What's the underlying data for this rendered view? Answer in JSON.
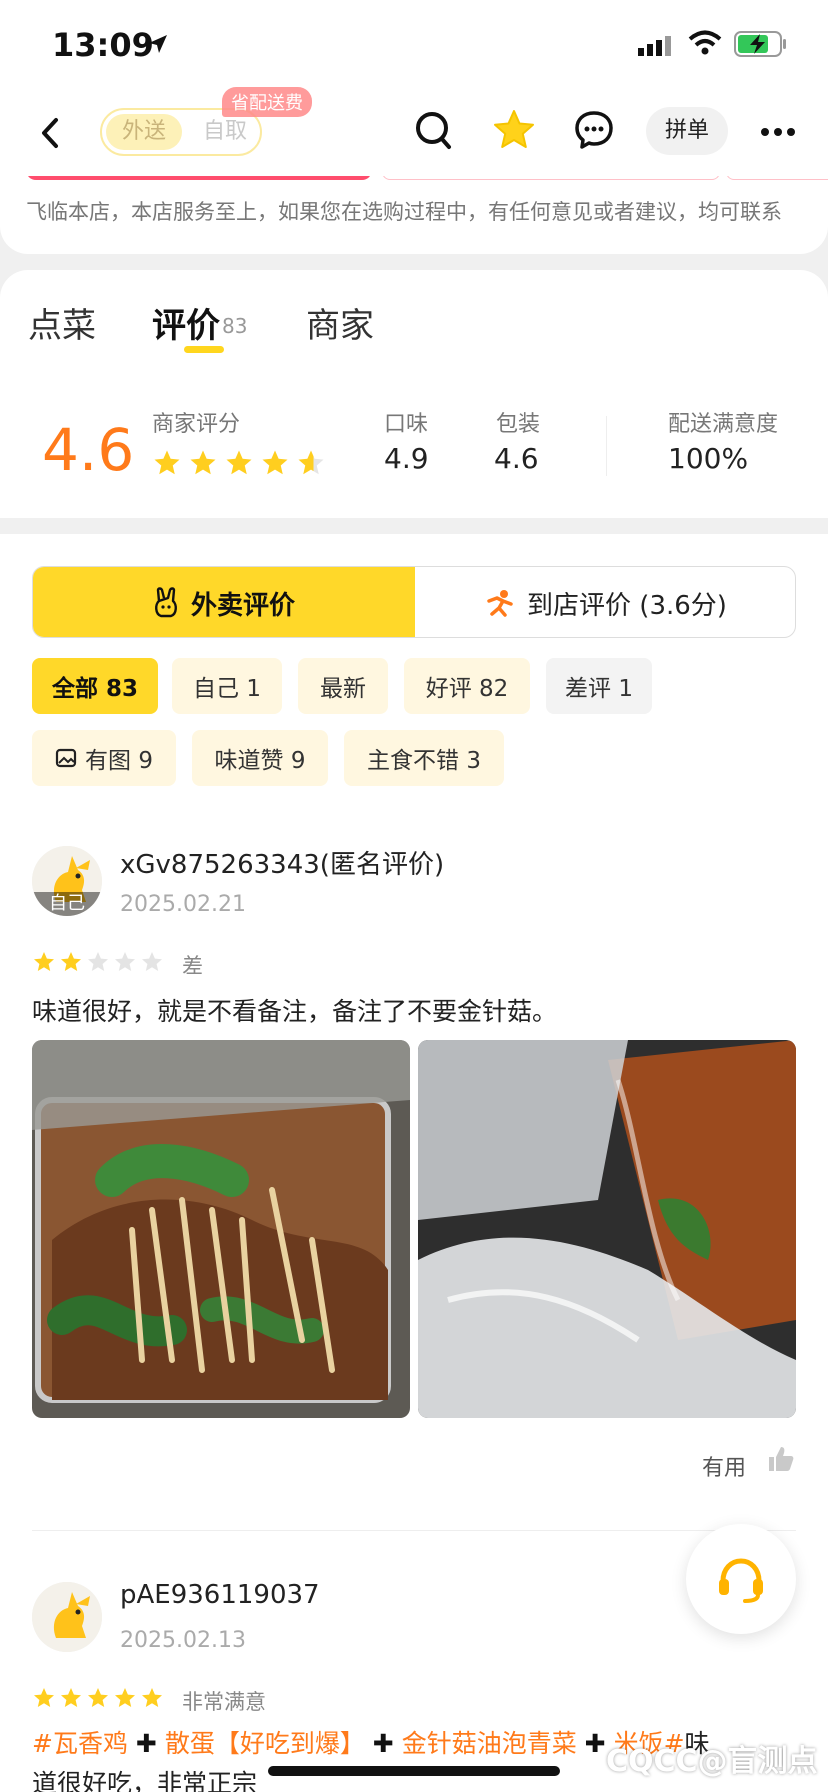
{
  "status_bar": {
    "time": "13:09"
  },
  "nav": {
    "seg_on": "外送",
    "seg_off": "自取",
    "promo_badge": "省配送费",
    "group_button": "拼单"
  },
  "notice": {
    "text": "飞临本店，本店服务至上，如果您在选购过程中，有任何意见或者建议，均可联系"
  },
  "tabs": [
    {
      "label": "点菜"
    },
    {
      "label": "评价",
      "count": "83"
    },
    {
      "label": "商家"
    }
  ],
  "rating": {
    "score": "4.6",
    "score_label": "商家评分",
    "stars": 4.6,
    "taste_label": "口味",
    "taste": "4.9",
    "package_label": "包装",
    "package": "4.6",
    "delivery_label": "配送满意度",
    "delivery": "100%"
  },
  "review_toggle": {
    "delivery": "外卖评价",
    "instore": "到店评价 (3.6分)"
  },
  "filters": [
    {
      "label": "全部 83"
    },
    {
      "label": "自己 1"
    },
    {
      "label": "最新"
    },
    {
      "label": "好评 82"
    },
    {
      "label": "差评 1"
    },
    {
      "label": "有图 9"
    },
    {
      "label": "味道赞 9"
    },
    {
      "label": "主食不错 3"
    }
  ],
  "reviews": [
    {
      "user": "xGv875263343(匿名评价)",
      "self_tag": "自己",
      "date": "2025.02.21",
      "stars": 2,
      "rating_label": "差",
      "text": "味道很好，就是不看备注，备注了不要金针菇。",
      "useful": "有用"
    },
    {
      "user": "pAE936119037",
      "date": "2025.02.13",
      "stars": 5,
      "rating_label": "非常满意",
      "tags": [
        "#瓦香鸡",
        "散蛋【好吃到爆】",
        "金针菇油泡青菜",
        "米饭#"
      ],
      "tail": "味",
      "text_line2": "道很好吃，非常正宗"
    }
  ],
  "watermark": "CQCC@盲测点"
}
